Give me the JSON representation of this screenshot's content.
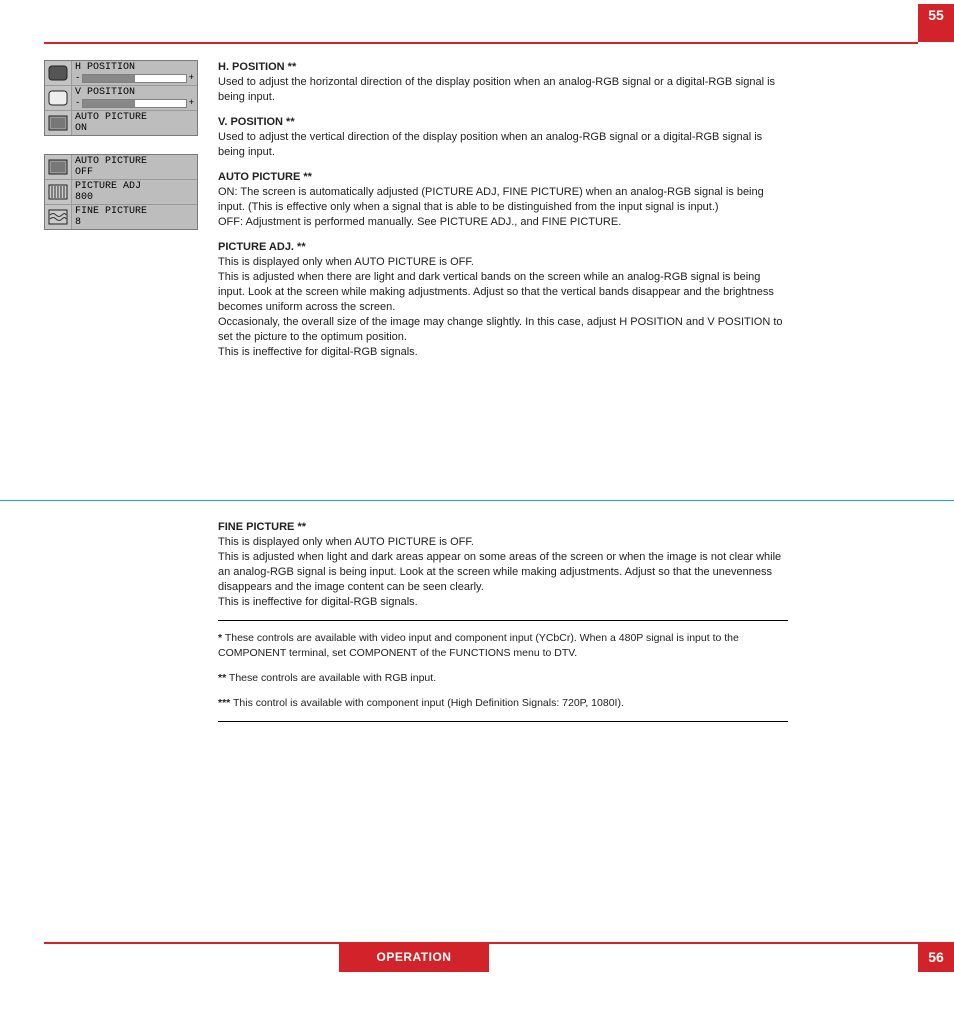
{
  "pageTop": "55",
  "pageBottom": "56",
  "footer": "OPERATION",
  "osd1": {
    "rows": [
      {
        "icon": "screen-dark",
        "title": "H POSITION",
        "type": "slider",
        "fill": 50
      },
      {
        "icon": "screen-light",
        "title": "V POSITION",
        "type": "slider",
        "fill": 50
      },
      {
        "icon": "auto-on",
        "title": "AUTO PICTURE",
        "type": "text",
        "value": "ON"
      }
    ]
  },
  "osd2": {
    "rows": [
      {
        "icon": "auto-off",
        "title": "AUTO PICTURE",
        "type": "text",
        "value": "OFF"
      },
      {
        "icon": "bars",
        "title": "PICTURE ADJ",
        "type": "text",
        "value": " 800"
      },
      {
        "icon": "wave",
        "title": "FINE PICTURE",
        "type": "text",
        "value": " 8"
      }
    ]
  },
  "sections": [
    {
      "label": "H. POSITION **",
      "body": "Used to adjust the horizontal direction of the display position when an analog-RGB signal or a digital-RGB signal is being input."
    },
    {
      "label": "V. POSITION **",
      "body": "Used to adjust the vertical direction of the display position when an analog-RGB signal or a digital-RGB signal is being input."
    },
    {
      "label": "AUTO PICTURE **",
      "body": "ON: The screen is automatically adjusted (PICTURE ADJ, FINE PICTURE) when an analog-RGB signal is being input. (This is effective only when a signal that is able to be distinguished from the input signal is input.)",
      "body2": "OFF: Adjustment is performed manually. See PICTURE ADJ., and FINE PICTURE."
    },
    {
      "label": "PICTURE ADJ. **",
      "body": "This is displayed only when AUTO PICTURE is OFF.",
      "body2": "This is adjusted when there are light and dark vertical bands on the screen while an analog-RGB signal is being input. Look at the screen while making adjustments. Adjust so that the vertical bands disappear and the brightness becomes uniform across the screen.",
      "body3": "Occasionaly, the overall size of the image may change slightly. In this case, adjust H POSITION and V POSITION to set the picture to the optimum position.",
      "body4": "This is ineffective for digital-RGB signals."
    },
    {
      "label": "FINE PICTURE **",
      "body": "This is displayed only when AUTO PICTURE is OFF.",
      "body2": "This is adjusted when light and dark areas appear on some areas of the screen or when the image is not clear while an analog-RGB signal is being input. Look at the screen while making adjustments. Adjust so that the unevenness disappears and the image content can be seen clearly.",
      "body3": "This is ineffective for digital-RGB signals."
    }
  ],
  "notes": [
    {
      "mark": "*",
      "text": "These controls are available with video input and component input (YCbCr). When a 480P signal is input to the COMPONENT terminal, set COMPONENT of the FUNCTIONS menu to DTV."
    },
    {
      "mark": "**",
      "text": "These controls are available with RGB input."
    },
    {
      "mark": "***",
      "text": "This control is available with component input (High Definition Signals: 720P, 1080I)."
    }
  ]
}
